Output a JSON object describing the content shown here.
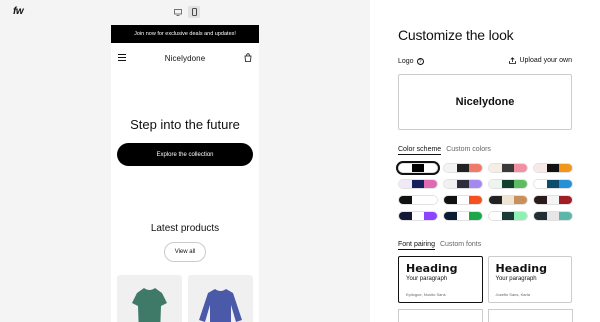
{
  "app": {
    "logo": "fw"
  },
  "preview": {
    "announcement": "Join now for exclusive deals and updates!",
    "store_name": "Nicelydone",
    "hero_title": "Step into the future",
    "hero_button": "Explore the collection",
    "latest_title": "Latest products",
    "view_all": "View all"
  },
  "panel": {
    "title": "Customize the look",
    "logo_label": "Logo",
    "upload_label": "Upload your own",
    "logo_preview": "Nicelydone",
    "color_tabs": [
      "Color scheme",
      "Custom colors"
    ],
    "font_tabs": [
      "Font pairing",
      "Custom fonts"
    ],
    "color_schemes": [
      [
        "#ffffff",
        "#000000",
        "#ffffff"
      ],
      [
        "#f3f3f3",
        "#222222",
        "#f07a6a"
      ],
      [
        "#f4efe2",
        "#3a3a3a",
        "#f28fa0"
      ],
      [
        "#f9e9e6",
        "#111111",
        "#f4951b"
      ],
      [
        "#efeaf7",
        "#13205c",
        "#e06ab2"
      ],
      [
        "#f1f1f1",
        "#2e2e3a",
        "#a389f0"
      ],
      [
        "#eef4ee",
        "#12402c",
        "#5dbb63"
      ],
      [
        "#ffffff",
        "#0e4c6b",
        "#2490d8"
      ],
      [
        "#111111",
        "#ffffff",
        "#ffffff"
      ],
      [
        "#111111",
        "#ffffff",
        "#f4511e"
      ],
      [
        "#222222",
        "#efe5d3",
        "#c98f5b"
      ],
      [
        "#2a1c1c",
        "#f4f4f4",
        "#a11e24"
      ],
      [
        "#141a33",
        "#ffffff",
        "#8e44ff"
      ],
      [
        "#0e1c33",
        "#ffffff",
        "#1ba84a"
      ],
      [
        "#ffffff",
        "#1b3a3a",
        "#8ff0b4"
      ],
      [
        "#213035",
        "#e6e6e6",
        "#5db7a8"
      ]
    ],
    "font_pairs": [
      {
        "heading": "Heading",
        "paragraph": "Your paragraph",
        "fonts": "Epilogue, Nunito Sans"
      },
      {
        "heading": "Heading",
        "paragraph": "Your paragraph",
        "fonts": "Josefin Sans, Karla"
      }
    ]
  }
}
